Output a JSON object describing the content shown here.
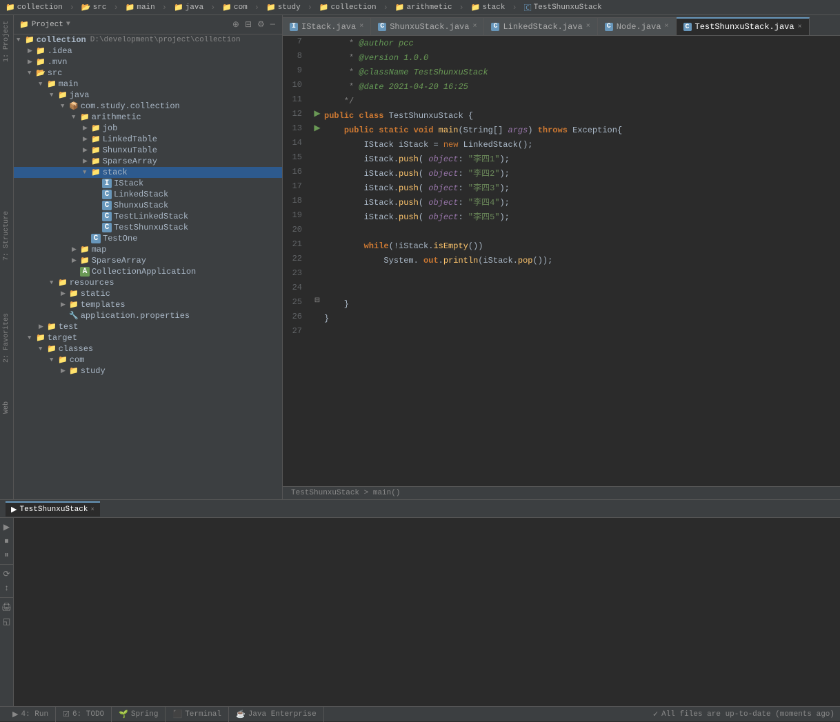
{
  "topbar": {
    "items": [
      {
        "label": "collection",
        "icon": "folder"
      },
      {
        "label": "src",
        "icon": "folder"
      },
      {
        "label": "main",
        "icon": "folder"
      },
      {
        "label": "java",
        "icon": "folder"
      },
      {
        "label": "com",
        "icon": "folder"
      },
      {
        "label": "study",
        "icon": "folder"
      },
      {
        "label": "collection",
        "icon": "folder"
      },
      {
        "label": "arithmetic",
        "icon": "folder"
      },
      {
        "label": "stack",
        "icon": "folder"
      },
      {
        "label": "TestShunxuStack",
        "icon": "class"
      }
    ]
  },
  "sidebar": {
    "title": "Project",
    "root": "collection",
    "root_path": "D:\\development\\project\\collection"
  },
  "tabs": [
    {
      "label": "IStack.java",
      "icon": "C",
      "active": false,
      "color": "#6897bb"
    },
    {
      "label": "ShunxuStack.java",
      "icon": "C",
      "active": false,
      "color": "#6897bb"
    },
    {
      "label": "LinkedStack.java",
      "icon": "C",
      "active": false,
      "color": "#6897bb"
    },
    {
      "label": "Node.java",
      "icon": "C",
      "active": false,
      "color": "#6897bb"
    },
    {
      "label": "TestShunxuStack.java",
      "icon": "C",
      "active": true,
      "color": "#6897bb"
    }
  ],
  "code": {
    "lines": [
      {
        "num": 7,
        "content": " * @author pcc",
        "type": "javadoc"
      },
      {
        "num": 8,
        "content": " * @version 1.0.0",
        "type": "javadoc"
      },
      {
        "num": 9,
        "content": " * @className TestShunxuStack",
        "type": "javadoc"
      },
      {
        "num": 10,
        "content": " * @date 2021-04-20 16:25",
        "type": "javadoc"
      },
      {
        "num": 11,
        "content": " */",
        "type": "cmt"
      },
      {
        "num": 12,
        "content": "public class TestShunxuStack {",
        "type": "code",
        "run": true
      },
      {
        "num": 13,
        "content": "    public static void main(String[] args) throws Exception{",
        "type": "code",
        "run": true
      },
      {
        "num": 14,
        "content": "        IStack iStack = new LinkedStack();",
        "type": "code"
      },
      {
        "num": 15,
        "content": "        iStack.push( object: \"李四1\");",
        "type": "code"
      },
      {
        "num": 16,
        "content": "        iStack.push( object: \"李四2\");",
        "type": "code"
      },
      {
        "num": 17,
        "content": "        iStack.push( object: \"李四3\");",
        "type": "code"
      },
      {
        "num": 18,
        "content": "        iStack.push( object: \"李四4\");",
        "type": "code"
      },
      {
        "num": 19,
        "content": "        iStack.push( object: \"李四5\");",
        "type": "code"
      },
      {
        "num": 20,
        "content": "",
        "type": "empty"
      },
      {
        "num": 21,
        "content": "        while(!iStack.isEmpty())",
        "type": "code"
      },
      {
        "num": 22,
        "content": "            System. out.println(iStack.pop());",
        "type": "code"
      },
      {
        "num": 23,
        "content": "",
        "type": "empty"
      },
      {
        "num": 24,
        "content": "",
        "type": "empty"
      },
      {
        "num": 25,
        "content": "    }",
        "type": "code",
        "fold": true
      },
      {
        "num": 26,
        "content": "}",
        "type": "code"
      },
      {
        "num": 27,
        "content": "",
        "type": "empty"
      }
    ],
    "breadcrumb": "TestShunxuStack > main()"
  },
  "tree": [
    {
      "label": "collection",
      "level": 0,
      "type": "root",
      "icon": "📁",
      "open": true,
      "path": "D:\\development\\project\\collection"
    },
    {
      "label": ".idea",
      "level": 1,
      "type": "folder",
      "open": false
    },
    {
      "label": ".mvn",
      "level": 1,
      "type": "folder",
      "open": false
    },
    {
      "label": "src",
      "level": 1,
      "type": "folder-src",
      "open": true
    },
    {
      "label": "main",
      "level": 2,
      "type": "folder-main",
      "open": true
    },
    {
      "label": "java",
      "level": 3,
      "type": "folder-java",
      "open": true
    },
    {
      "label": "com.study.collection",
      "level": 4,
      "type": "package",
      "open": true
    },
    {
      "label": "arithmetic",
      "level": 5,
      "type": "folder-blue",
      "open": true
    },
    {
      "label": "job",
      "level": 6,
      "type": "folder-blue",
      "open": false
    },
    {
      "label": "LinkedTable",
      "level": 6,
      "type": "folder-blue",
      "open": false
    },
    {
      "label": "ShunxuTable",
      "level": 6,
      "type": "folder-blue",
      "open": false
    },
    {
      "label": "SparseArray",
      "level": 6,
      "type": "folder-blue",
      "open": false
    },
    {
      "label": "stack",
      "level": 6,
      "type": "folder-blue",
      "open": true,
      "selected": true
    },
    {
      "label": "IStack",
      "level": 7,
      "type": "class",
      "icon": "C"
    },
    {
      "label": "LinkedStack",
      "level": 7,
      "type": "class",
      "icon": "C"
    },
    {
      "label": "ShunxuStack",
      "level": 7,
      "type": "class",
      "icon": "C"
    },
    {
      "label": "TestLinkedStack",
      "level": 7,
      "type": "class",
      "icon": "C"
    },
    {
      "label": "TestShunxuStack",
      "level": 7,
      "type": "class",
      "icon": "C"
    },
    {
      "label": "TestOne",
      "level": 6,
      "type": "class",
      "icon": "C"
    },
    {
      "label": "map",
      "level": 5,
      "type": "folder-blue",
      "open": false
    },
    {
      "label": "SparseArray",
      "level": 5,
      "type": "folder-blue",
      "open": false
    },
    {
      "label": "CollectionApplication",
      "level": 5,
      "type": "class-spring",
      "icon": "A"
    },
    {
      "label": "resources",
      "level": 4,
      "type": "folder-resources",
      "open": true
    },
    {
      "label": "static",
      "level": 5,
      "type": "folder-blue",
      "open": false
    },
    {
      "label": "templates",
      "level": 5,
      "type": "folder-blue",
      "open": false
    },
    {
      "label": "application.properties",
      "level": 5,
      "type": "props"
    },
    {
      "label": "test",
      "level": 2,
      "type": "folder-blue",
      "open": false
    },
    {
      "label": "target",
      "level": 1,
      "type": "folder-main",
      "open": true
    },
    {
      "label": "classes",
      "level": 2,
      "type": "folder-blue",
      "open": true
    },
    {
      "label": "com",
      "level": 3,
      "type": "folder-blue",
      "open": true
    },
    {
      "label": "study",
      "level": 4,
      "type": "folder-blue",
      "open": false
    }
  ],
  "bottom": {
    "run_tab": "TestShunxuStack",
    "toolbar_buttons": [
      "▶",
      "⏹",
      "⏸",
      "≡",
      "↕",
      "⇄",
      "🖨",
      "◱"
    ],
    "output": ""
  },
  "status_bar": {
    "message": "All files are up-to-date (moments ago)",
    "tabs": [
      "4: Run",
      "6: TODO",
      "Spring",
      "Terminal",
      "Java Enterprise"
    ]
  },
  "side_labels": [
    "Structure",
    "Favorites",
    "Web"
  ]
}
